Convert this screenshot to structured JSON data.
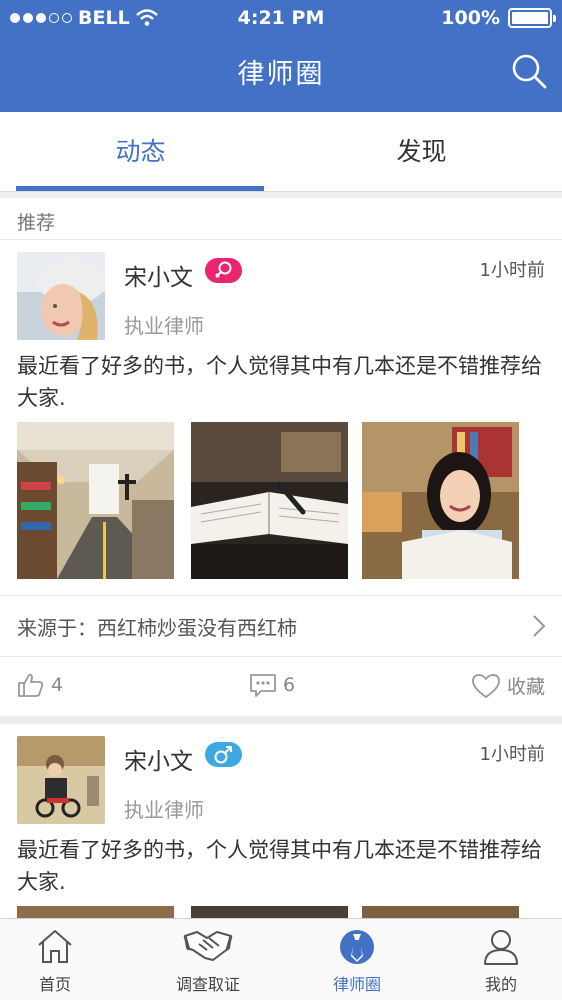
{
  "status_bar": {
    "carrier": "BELL",
    "time": "4:21 PM",
    "battery": "100%"
  },
  "header": {
    "title": "律师圈",
    "search_icon": "search-icon"
  },
  "tabs": [
    {
      "label": "动态",
      "active": true
    },
    {
      "label": "发现",
      "active": false
    }
  ],
  "section_label": "推荐",
  "posts": [
    {
      "name": "宋小文",
      "gender": "female",
      "role": "执业律师",
      "time": "1小时前",
      "content": "最近看了好多的书，个人觉得其中有几本还是不错推荐给大家.",
      "source": "来源于：西红柿炒蛋没有西红柿",
      "likes": "4",
      "comments": "6",
      "favorite_label": "收藏"
    },
    {
      "name": "宋小文",
      "gender": "male",
      "role": "执业律师",
      "time": "1小时前",
      "content": "最近看了好多的书，个人觉得其中有几本还是不错推荐给大家."
    }
  ],
  "tabbar": [
    {
      "label": "首页",
      "icon": "home-icon",
      "active": false
    },
    {
      "label": "调查取证",
      "icon": "handshake-icon",
      "active": false
    },
    {
      "label": "律师圈",
      "icon": "lawyer-tie-icon",
      "active": true
    },
    {
      "label": "我的",
      "icon": "person-icon",
      "active": false
    }
  ],
  "colors": {
    "primary": "#4271c6",
    "female_badge": "#e8256e",
    "male_badge": "#3fa8e0"
  }
}
